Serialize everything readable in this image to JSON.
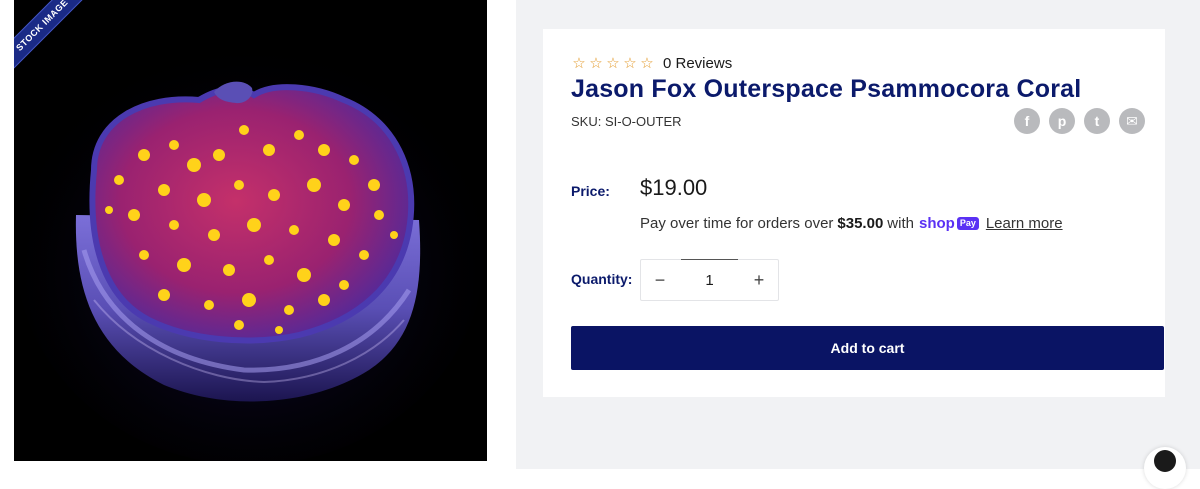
{
  "image": {
    "ribbon_text": "STOCK IMAGE"
  },
  "product": {
    "reviews": {
      "stars_empty": [
        "☆",
        "☆",
        "☆",
        "☆",
        "☆"
      ],
      "count_label": "0 Reviews"
    },
    "title": "Jason Fox Outerspace Psammocora Coral",
    "sku": "SKU: SI-O-OUTER",
    "share": [
      {
        "icon": "facebook-icon",
        "glyph": "f"
      },
      {
        "icon": "pinterest-icon",
        "glyph": "p"
      },
      {
        "icon": "twitter-icon",
        "glyph": "t"
      },
      {
        "icon": "email-icon",
        "glyph": "✉"
      }
    ],
    "price_label": "Price:",
    "price": "$19.00",
    "installments": {
      "prefix": "Pay over time for orders over",
      "threshold": "$35.00",
      "suffix": "with",
      "shop_pay_word": "shop",
      "shop_pay_pill": "Pay",
      "learn_more": "Learn more"
    },
    "quantity_label": "Quantity:",
    "quantity": {
      "value": "1",
      "minus": "−",
      "plus": "+"
    },
    "add_to_cart": "Add to cart"
  },
  "colors": {
    "title": "#0b1a6b",
    "cart_button": "#0a1464",
    "stars": "#e39a2b",
    "shop_pay": "#5a31f4"
  }
}
